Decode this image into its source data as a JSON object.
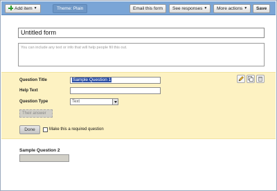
{
  "toolbar": {
    "add_item_label": "Add item",
    "theme_label": "Theme:  Plain",
    "email_label": "Email this form",
    "responses_label": "See responses",
    "more_actions_label": "More actions",
    "save_label": "Save"
  },
  "form": {
    "title": "Untitled form",
    "description_placeholder": "You can include any text or info that will help people fill this out."
  },
  "editor": {
    "question_title_label": "Question Title",
    "question_title_value": "Sample Question 1",
    "help_text_label": "Help Text",
    "help_text_value": "",
    "question_type_label": "Question Type",
    "question_type_value": "Text",
    "answer_placeholder": "Their answer",
    "done_label": "Done",
    "required_label": "Make this a required question",
    "required_checked": false,
    "icons": [
      "pencil-icon",
      "duplicate-icon",
      "trash-icon"
    ]
  },
  "next_question": {
    "title": "Sample Question 2"
  },
  "colors": {
    "toolbar_bg": "#7aa5d6",
    "editor_bg": "#fdf2c2",
    "selection": "#2b4fa6",
    "add_icon": "#2a9a2a"
  }
}
